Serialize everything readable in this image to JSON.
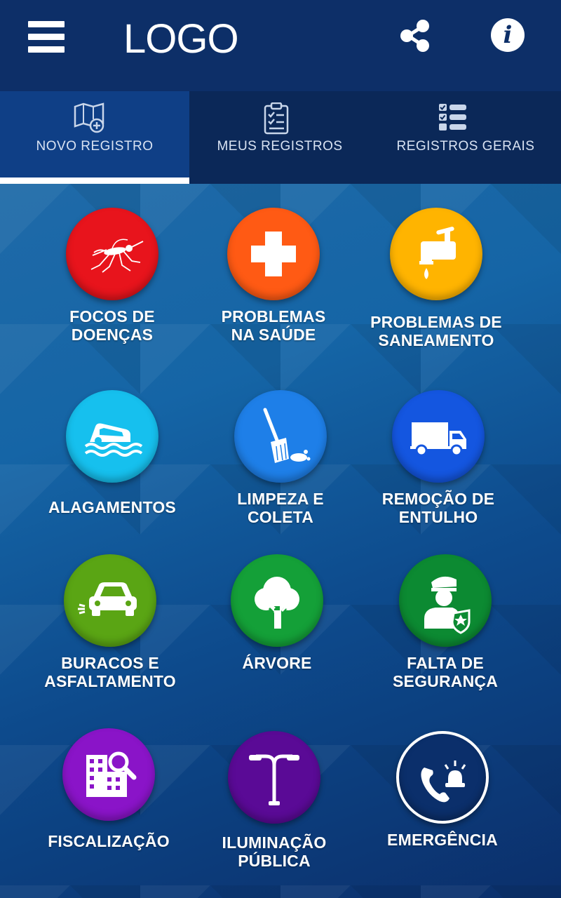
{
  "header": {
    "logo": "LOGO",
    "menu_icon": "hamburger-menu-icon",
    "share_icon": "share-icon",
    "info_icon": "info-icon",
    "info_glyph": "i"
  },
  "tabs": [
    {
      "label": "NOVO REGISTRO",
      "icon": "map-add-icon",
      "active": true
    },
    {
      "label": "MEUS REGISTROS",
      "icon": "clipboard-checklist-icon",
      "active": false
    },
    {
      "label": "REGISTROS GERAIS",
      "icon": "checklist-icon",
      "active": false
    }
  ],
  "categories": [
    {
      "label": "FOCOS DE\nDOENÇAS",
      "icon": "mosquito-icon",
      "color": "#e8141c"
    },
    {
      "label": "PROBLEMAS\nNA SAÚDE",
      "icon": "medical-cross-icon",
      "color": "#ff5a14"
    },
    {
      "label": "PROBLEMAS DE\nSANEAMENTO",
      "icon": "faucet-drop-icon",
      "color": "#ffb400"
    },
    {
      "label": "ALAGAMENTOS",
      "icon": "flooded-car-icon",
      "color": "#16c0ee"
    },
    {
      "label": "LIMPEZA E\nCOLETA",
      "icon": "broom-icon",
      "color": "#1e7fe8"
    },
    {
      "label": "REMOÇÃO DE\nENTULHO",
      "icon": "truck-icon",
      "color": "#1456e0"
    },
    {
      "label": "BURACOS E\nASFALTAMENTO",
      "icon": "car-pothole-icon",
      "color": "#5aa514"
    },
    {
      "label": "ÁRVORE",
      "icon": "tree-icon",
      "color": "#14a038"
    },
    {
      "label": "FALTA DE\nSEGURANÇA",
      "icon": "police-officer-icon",
      "color": "#0c8a32"
    },
    {
      "label": "FISCALIZAÇÃO",
      "icon": "buildings-search-icon",
      "color": "#8a14c8"
    },
    {
      "label": "ILUMINAÇÃO\nPÚBLICA",
      "icon": "street-lamp-icon",
      "color": "#5a0a96"
    },
    {
      "label": "EMERGÊNCIA",
      "icon": "emergency-phone-siren-icon",
      "color": "#0b2f6b"
    }
  ]
}
